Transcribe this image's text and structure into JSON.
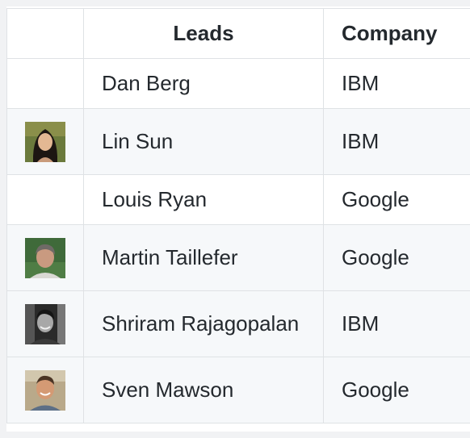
{
  "table": {
    "headers": {
      "photo": "",
      "leads": "Leads",
      "company": "Company"
    },
    "rows": [
      {
        "name": "Dan Berg",
        "company": "IBM",
        "photo": ""
      },
      {
        "name": "Lin Sun",
        "company": "IBM",
        "photo": "avatar-photo"
      },
      {
        "name": "Louis Ryan",
        "company": "Google",
        "photo": ""
      },
      {
        "name": "Martin Taillefer",
        "company": "Google",
        "photo": "avatar-photo"
      },
      {
        "name": "Shriram Rajagopalan",
        "company": "IBM",
        "photo": "avatar-photo"
      },
      {
        "name": "Sven Mawson",
        "company": "Google",
        "photo": "avatar-photo"
      }
    ]
  },
  "colors": {
    "border": "#dfe2e5",
    "stripe": "#f6f8fa",
    "text": "#24292e"
  }
}
